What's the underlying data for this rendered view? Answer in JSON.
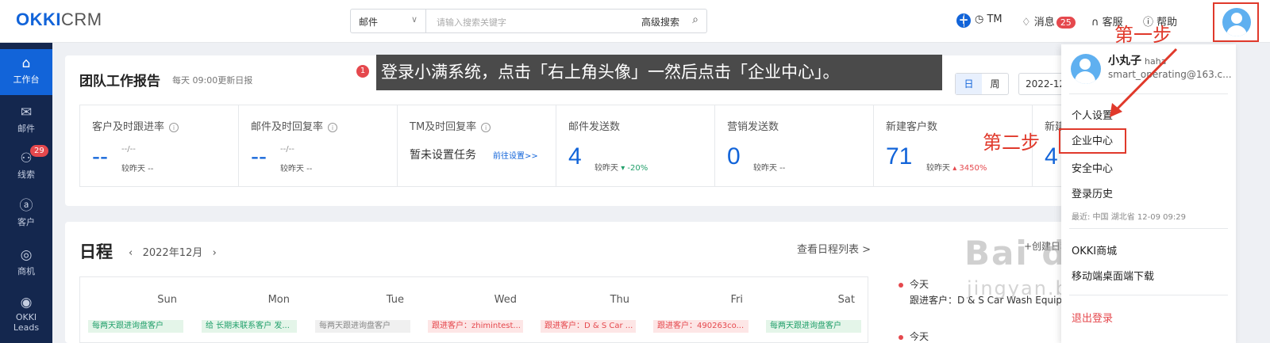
{
  "app": {
    "logo_bold": "OKKI",
    "logo_light": "CRM"
  },
  "search": {
    "type_value": "邮件",
    "placeholder": "请输入搜索关键字",
    "advanced": "高级搜索"
  },
  "topbar": {
    "tm": "TM",
    "messages": "消息",
    "messages_count": "25",
    "service": "客服",
    "help": "帮助"
  },
  "sidebar": {
    "items": [
      {
        "label": "工作台",
        "icon": "home-icon"
      },
      {
        "label": "邮件",
        "icon": "mail-icon"
      },
      {
        "label": "线索",
        "icon": "leads-icon",
        "badge": "29"
      },
      {
        "label": "客户",
        "icon": "customer-icon"
      },
      {
        "label": "商机",
        "icon": "opportunity-icon"
      },
      {
        "label": "OKKI Leads",
        "icon": "okki-leads-icon"
      }
    ]
  },
  "report": {
    "title": "团队工作报告",
    "subtitle": "每天 09:00更新日报",
    "tab_day": "日",
    "tab_week": "周",
    "date": "2022-12",
    "metrics": [
      {
        "label": "客户及时跟进率",
        "value": "--",
        "ratio": "--/--",
        "compare": "较昨天 --"
      },
      {
        "label": "邮件及时回复率",
        "value": "--",
        "ratio": "--/--",
        "compare": "较昨天 --"
      },
      {
        "label": "TM及时回复率",
        "value": "暂未设置任务",
        "link": "前往设置>>"
      },
      {
        "label": "邮件发送数",
        "value": "4",
        "compare": "较昨天",
        "change": "-20%"
      },
      {
        "label": "营销发送数",
        "value": "0",
        "compare": "较昨天 --"
      },
      {
        "label": "新建客户数",
        "value": "71",
        "compare": "较昨天",
        "change": "3450%"
      },
      {
        "label": "新建",
        "value": "4"
      }
    ]
  },
  "tooltip": {
    "step": "1",
    "text": "登录小满系统，点击「右上角头像」一然后点击「企业中心」。"
  },
  "schedule": {
    "title": "日程",
    "month": "2022年12月",
    "view_list": "查看日程列表 >",
    "days": [
      "Sun",
      "Mon",
      "Tue",
      "Wed",
      "Thu",
      "Fri",
      "Sat"
    ],
    "events": [
      "每两天跟进询盘客户",
      "给 长期未联系客户 发...",
      "每两天跟进询盘客户",
      "跟进客户：zhimintest...",
      "跟进客户：D & S Car ...",
      "跟进客户：490263co...",
      "每两天跟进询盘客户"
    ],
    "create_link": "+创建日程",
    "todo_today": "今天",
    "todo_text": "跟进客户：D & S Car Wash Equip",
    "todo_today2": "今天"
  },
  "dropdown": {
    "name": "小丸子",
    "nickname": "haha",
    "email": "smart_operating@163.c...",
    "items": [
      "个人设置",
      "企业中心",
      "安全中心",
      "登录历史"
    ],
    "history": "最近: 中国 湖北省 12-09 09:29",
    "okki_link": "OKKI商城",
    "mobile": "移动端桌面端下载",
    "logout": "退出登录"
  },
  "annotations": {
    "step1": "第一步",
    "step2": "第二步"
  },
  "watermark": {
    "main": "Bai du 经验",
    "url": "jingyan.baidu.com"
  },
  "colors": {
    "brand": "#1264d9",
    "sidebar": "#14274e",
    "annotation": "#e0392b"
  }
}
